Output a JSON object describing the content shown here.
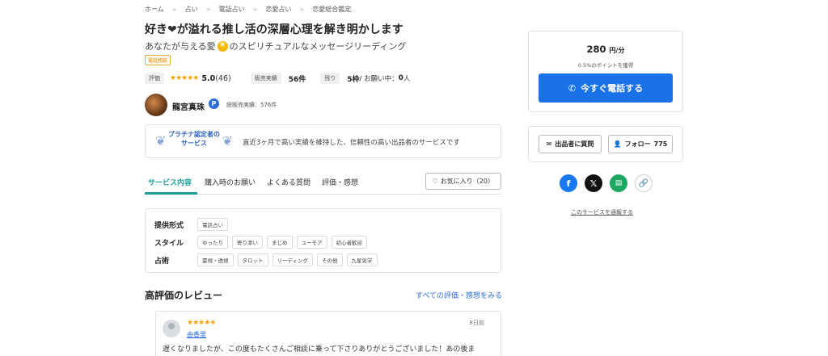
{
  "breadcrumb": [
    "ホーム",
    "占い",
    "電話占い",
    "恋愛占い",
    "恋愛総合鑑定"
  ],
  "title_before": "好き",
  "title_after": "が溢れる推し活の深層心理を解き明かします",
  "subtitle_before": "あなたが与える愛",
  "subtitle_after": "のスピリチュアルなメッセージリーディング",
  "category_tag": "電話相談",
  "stats": {
    "rating_label": "評価",
    "stars": "★★★★★",
    "rating_value": "5.0",
    "rating_count": "(46)",
    "sales_label": "販売実績",
    "sales_value": "56件",
    "remain_label": "残り",
    "remain_value": "5枠",
    "waiting_text": " / お願い中：",
    "waiting_value": "0",
    "waiting_unit": "人"
  },
  "seller": {
    "name": "龍宮真珠",
    "badge": "P",
    "total_sales": "総販売実績：576件"
  },
  "platinum": {
    "badge_line1": "プラチナ認定者の",
    "badge_line2": "サービス",
    "text": "直近3ヶ月で高い実績を維持した、信頼性の高い出品者のサービスです"
  },
  "tabs": [
    "サービス内容",
    "購入時のお願い",
    "よくある質問",
    "評価・感想"
  ],
  "favorite_button": "お気に入り（20）",
  "info": {
    "rows": [
      {
        "label": "提供形式",
        "tags": [
          "電話占い"
        ]
      },
      {
        "label": "スタイル",
        "tags": [
          "ゆったり",
          "寄り添い",
          "まじめ",
          "ユーモア",
          "初心者歓迎"
        ]
      },
      {
        "label": "占術",
        "tags": [
          "霊視・透視",
          "タロット",
          "リーディング",
          "その他",
          "九星気学"
        ]
      }
    ]
  },
  "reviews": {
    "heading": "高評価のレビュー",
    "all_link": "すべての評価・感想をみる",
    "items": [
      {
        "stars": "★★★★★",
        "name": "由香里",
        "date": "8日前",
        "text": "遅くなりましたが、この度もたくさんご相談に乗って下さりありがとうございました！あの後ま"
      }
    ]
  },
  "pricing": {
    "price": "280",
    "unit": "円/分",
    "points": "0.5%のポイントを獲得",
    "call_button": "今すぐ電話する"
  },
  "actions": {
    "ask_button": "出品者に質問",
    "follow_button": "フォロー",
    "follow_count": "775"
  },
  "share": {
    "report_link": "このサービスを通報する"
  },
  "colors": {
    "accent_teal": "#1c9e96",
    "call_blue": "#1a72e8",
    "star_orange": "#f5a300",
    "link_blue": "#2b6bd8"
  }
}
